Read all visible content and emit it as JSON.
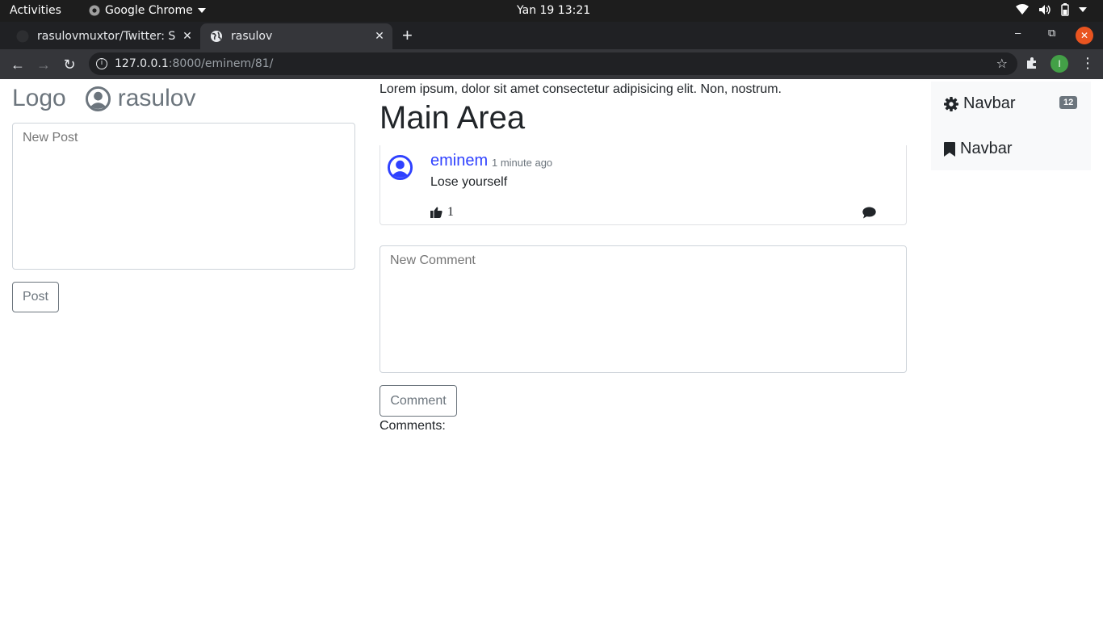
{
  "system_bar": {
    "activities": "Activities",
    "app_name": "Google Chrome",
    "clock": "Yan 19  13:21"
  },
  "browser": {
    "tabs": [
      {
        "title": "rasulovmuxtor/Twitter: S",
        "active": false
      },
      {
        "title": "rasulov",
        "active": true
      }
    ],
    "url_host": "127.0.0.1",
    "url_rest": ":8000/eminem/81/",
    "profile_initial": "I"
  },
  "page": {
    "brand": "Logo",
    "username": "rasulov",
    "new_post_placeholder": "New Post",
    "post_button": "Post",
    "lead_text": "Lorem ipsum, dolor sit amet consectetur adipisicing elit. Non, nostrum.",
    "main_title": "Main Area",
    "post": {
      "author": "eminem",
      "time": "1 minute ago",
      "text": "Lose yourself",
      "likes": "1"
    },
    "new_comment_placeholder": "New Comment",
    "comment_button": "Comment",
    "comments_label": "Comments:",
    "sidenav": {
      "items": [
        {
          "label": "Navbar",
          "icon": "gear-icon",
          "badge": "12"
        },
        {
          "label": "Navbar",
          "icon": "bookmark-icon"
        }
      ]
    }
  }
}
